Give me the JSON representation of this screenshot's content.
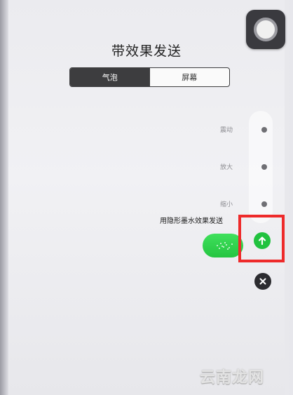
{
  "title": "带效果发送",
  "tabs": [
    {
      "label": "气泡",
      "active": true
    },
    {
      "label": "屏幕",
      "active": false
    }
  ],
  "effects": [
    {
      "label": "震动"
    },
    {
      "label": "放大"
    },
    {
      "label": "缩小"
    },
    {
      "label": "用隐形墨水效果发送"
    }
  ],
  "icons": {
    "send": "arrow-up-icon",
    "close": "close-icon",
    "assistive_touch": "assistive-touch-icon"
  },
  "colors": {
    "send_green": "#21c23f",
    "highlight_red": "#ee2a2a",
    "tab_dark": "#3d3d3f"
  },
  "watermark": "云南龙网"
}
